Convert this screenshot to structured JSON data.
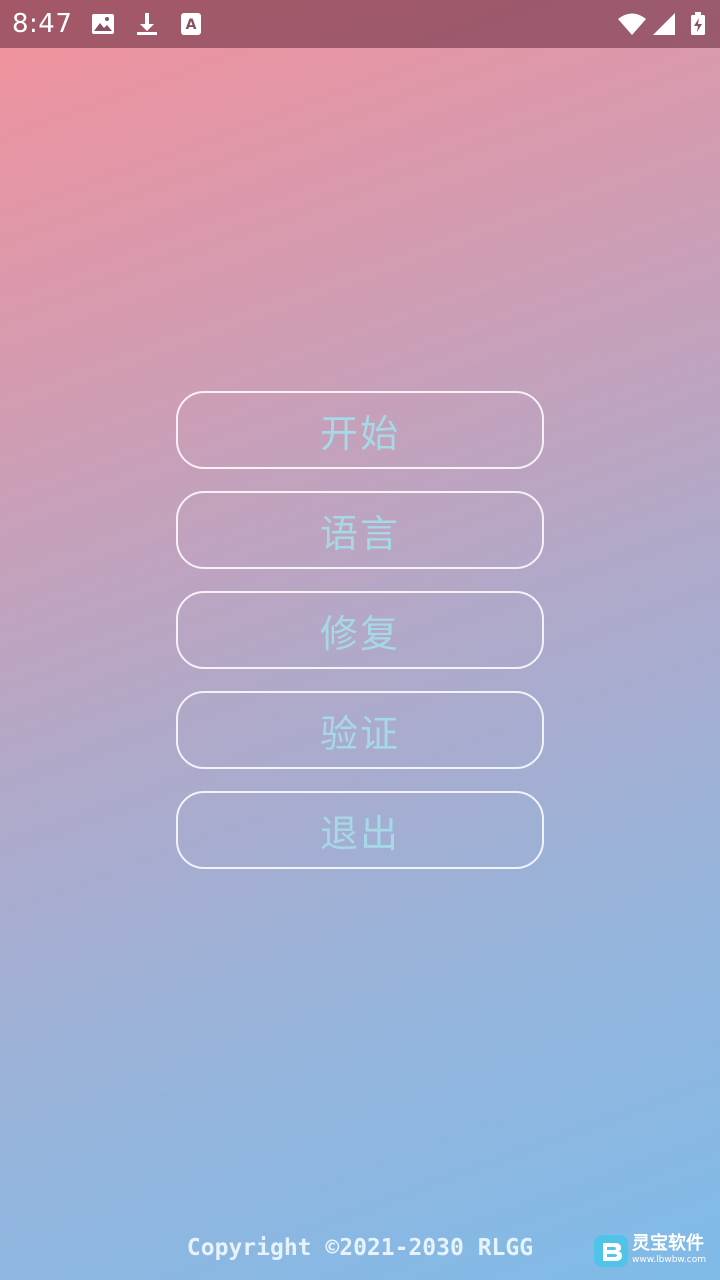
{
  "status_bar": {
    "time": "8:47",
    "left_icons": [
      "image-icon",
      "download-icon",
      "font-a-icon"
    ],
    "right_icons": [
      "wifi-icon",
      "signal-icon",
      "battery-charging-icon"
    ]
  },
  "menu": {
    "buttons": [
      {
        "label": "开始",
        "name": "start-button"
      },
      {
        "label": "语言",
        "name": "language-button"
      },
      {
        "label": "修复",
        "name": "repair-button"
      },
      {
        "label": "验证",
        "name": "verify-button"
      },
      {
        "label": "退出",
        "name": "exit-button"
      }
    ]
  },
  "footer": {
    "copyright": "Copyright ©2021-2030 RLGG"
  },
  "watermark": {
    "title": "灵宝软件",
    "url": "www.lbwbw.com"
  },
  "colors": {
    "gradient_top": "#f2919b",
    "gradient_bottom": "#7fbbe8",
    "button_text": "#a6d8e6",
    "button_border": "#ffffff"
  }
}
